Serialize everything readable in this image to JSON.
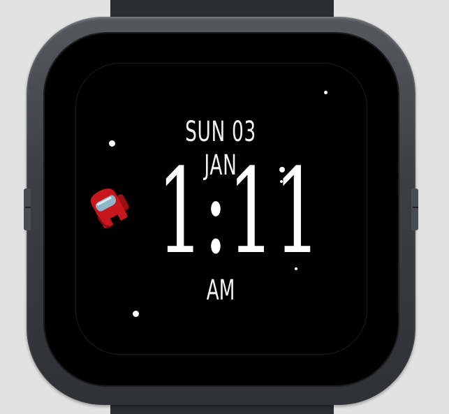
{
  "watch_face": {
    "date": "SUN 03 JAN",
    "time": "1:11",
    "meridiem": "AM"
  },
  "icons": {
    "character": "crewmate-icon",
    "decoration": "star-icon"
  },
  "colors": {
    "background": "#e2e2e2",
    "screen": "#000000",
    "text": "#ffffff",
    "crewmate_body": "#c8171c",
    "crewmate_visor": "#8fb6c8"
  }
}
